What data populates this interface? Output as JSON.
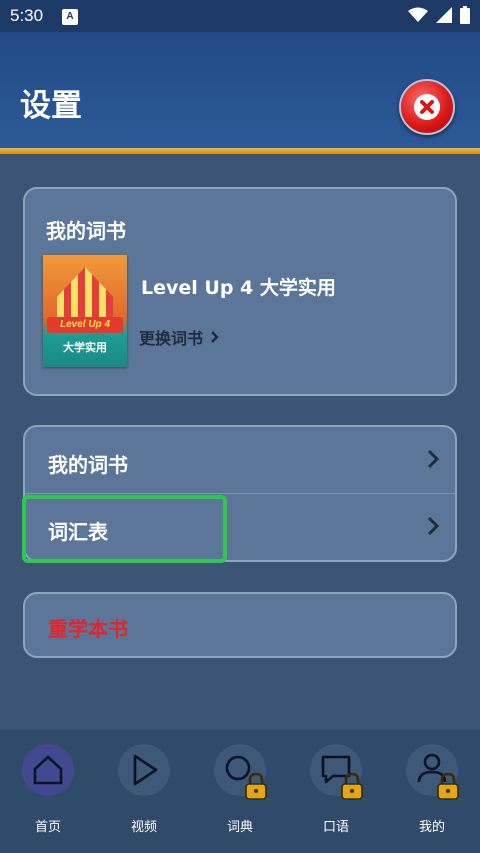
{
  "status_bar": {
    "time": "5:30",
    "notification_letter": "A"
  },
  "header": {
    "title": "设置"
  },
  "book_card": {
    "title": "我的词书",
    "book_name": "Level Up 4 大学实用",
    "cover_level_text": "Level Up 4",
    "cover_subtitle": "大学实用",
    "change_label": "更换词书"
  },
  "menu": {
    "items": [
      {
        "label": "我的词书"
      },
      {
        "label": "词汇表"
      }
    ]
  },
  "relearn": {
    "label": "重学本书",
    "color": "#e0262a"
  },
  "bottom_nav": {
    "items": [
      {
        "label": "首页",
        "icon": "home-icon",
        "active": true,
        "locked": false
      },
      {
        "label": "视频",
        "icon": "play-icon",
        "active": false,
        "locked": false
      },
      {
        "label": "词典",
        "icon": "search-icon",
        "active": false,
        "locked": true
      },
      {
        "label": "口语",
        "icon": "chat-icon",
        "active": false,
        "locked": true
      },
      {
        "label": "我的",
        "icon": "profile-icon",
        "active": false,
        "locked": true
      }
    ]
  },
  "colors": {
    "highlight": "#2ec84a",
    "header_stripe": "#f4b93a",
    "close_button": "#d81616"
  }
}
